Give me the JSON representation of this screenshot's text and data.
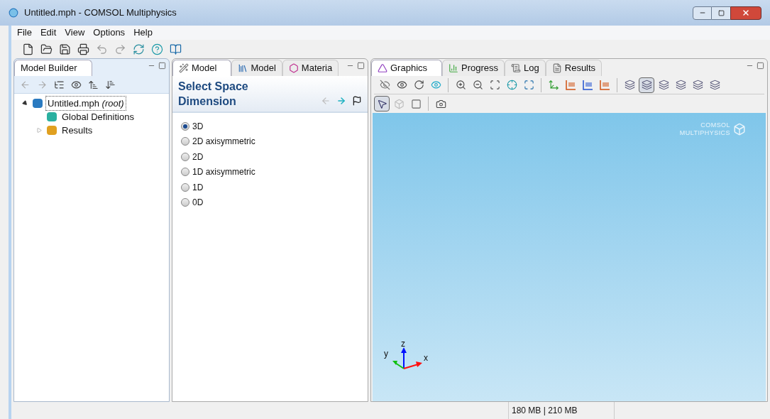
{
  "window": {
    "title": "Untitled.mph - COMSOL Multiphysics"
  },
  "menu": [
    "File",
    "Edit",
    "View",
    "Options",
    "Help"
  ],
  "main_toolbar": [
    {
      "kind": "new"
    },
    {
      "kind": "open"
    },
    {
      "kind": "save"
    },
    {
      "kind": "print"
    },
    {
      "kind": "undo"
    },
    {
      "kind": "redo"
    },
    {
      "kind": "refresh"
    },
    {
      "kind": "help"
    },
    {
      "kind": "docs"
    }
  ],
  "model_builder": {
    "tabs": [
      {
        "label": "Model Builder",
        "selected": true
      }
    ],
    "toolbar": [
      {
        "kind": "back"
      },
      {
        "kind": "forward"
      },
      {
        "kind": "list"
      },
      {
        "kind": "show"
      },
      {
        "kind": "sortup"
      },
      {
        "kind": "sortdown"
      }
    ],
    "tree": [
      {
        "label": "Untitled.mph *(root)*",
        "expanded": true,
        "kind": "model",
        "selected": true,
        "children": [
          {
            "label": "Global Definitions",
            "kind": "defs",
            "selected": false
          },
          {
            "label": "Results",
            "kind": "results",
            "expanded": false,
            "selected": false
          }
        ]
      }
    ]
  },
  "wizard": {
    "tabs": [
      {
        "label": "Model",
        "selected": true,
        "kind": "wand"
      },
      {
        "label": "Model",
        "selected": false,
        "kind": "library"
      },
      {
        "label": "Materia",
        "selected": false,
        "kind": "material"
      }
    ],
    "heading": "Select Space Dimension",
    "options": [
      {
        "label": "3D",
        "selected": true
      },
      {
        "label": "2D axisymmetric",
        "selected": false
      },
      {
        "label": "2D",
        "selected": false
      },
      {
        "label": "1D axisymmetric",
        "selected": false
      },
      {
        "label": "1D",
        "selected": false
      },
      {
        "label": "0D",
        "selected": false
      }
    ]
  },
  "graphics": {
    "tabs": [
      {
        "label": "Graphics",
        "selected": true,
        "kind": "graphics"
      },
      {
        "label": "Progress",
        "selected": false,
        "kind": "progress"
      },
      {
        "label": "Log",
        "selected": false,
        "kind": "log"
      },
      {
        "label": "Results",
        "selected": false,
        "kind": "results"
      }
    ],
    "toolbar": [
      {
        "kind": "hide",
        "pressed": false
      },
      {
        "kind": "eye",
        "pressed": false
      },
      {
        "kind": "rotate",
        "pressed": false
      },
      {
        "kind": "view",
        "pressed": false
      },
      {
        "kind": "sep"
      },
      {
        "kind": "zoomin",
        "pressed": false
      },
      {
        "kind": "zoomout",
        "pressed": false
      },
      {
        "kind": "zoombox",
        "pressed": false
      },
      {
        "kind": "center",
        "pressed": false
      },
      {
        "kind": "extents",
        "pressed": false
      },
      {
        "kind": "sep"
      },
      {
        "kind": "axes",
        "pressed": false
      },
      {
        "kind": "xy",
        "pressed": false
      },
      {
        "kind": "yz",
        "pressed": false
      },
      {
        "kind": "zx",
        "pressed": false
      },
      {
        "kind": "sep"
      },
      {
        "kind": "shape",
        "pressed": false
      },
      {
        "kind": "shape",
        "pressed": true
      },
      {
        "kind": "shape",
        "pressed": false
      },
      {
        "kind": "shape",
        "pressed": false
      },
      {
        "kind": "shape",
        "pressed": false
      },
      {
        "kind": "shape",
        "pressed": false
      }
    ],
    "toolbar_2": [
      {
        "kind": "select",
        "pressed": true
      },
      {
        "kind": "cube",
        "pressed": false
      },
      {
        "kind": "wire",
        "pressed": false
      },
      {
        "kind": "sep"
      },
      {
        "kind": "camera",
        "pressed": false
      }
    ],
    "logo": [
      "COMSOL",
      "MULTIPHYSICS"
    ],
    "axes": {
      "x": "x",
      "y": "y",
      "z": "z"
    }
  },
  "status_bar": {
    "memory": "180 MB | 210 MB"
  }
}
